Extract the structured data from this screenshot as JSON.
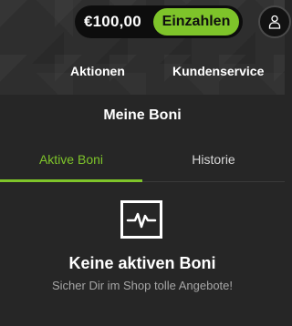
{
  "header": {
    "balance": "€100,00",
    "deposit_label": "Einzahlen",
    "account_icon": "user-icon"
  },
  "nav": {
    "items": [
      {
        "label": "Aktionen"
      },
      {
        "label": "Kundenservice"
      }
    ]
  },
  "bonuses": {
    "title": "Meine Boni",
    "tabs": [
      {
        "label": "Aktive Boni",
        "active": true
      },
      {
        "label": "Historie",
        "active": false
      }
    ],
    "empty_state": {
      "icon": "activity-monitor-icon",
      "title": "Keine aktiven Boni",
      "subtitle": "Sicher Dir im Shop tolle Angebote!"
    }
  },
  "colors": {
    "accent": "#7ec42a",
    "background": "#262626",
    "header_background": "#2e2e2e",
    "pill_background": "#0d0d0d",
    "muted_text": "#a6a6a6"
  }
}
